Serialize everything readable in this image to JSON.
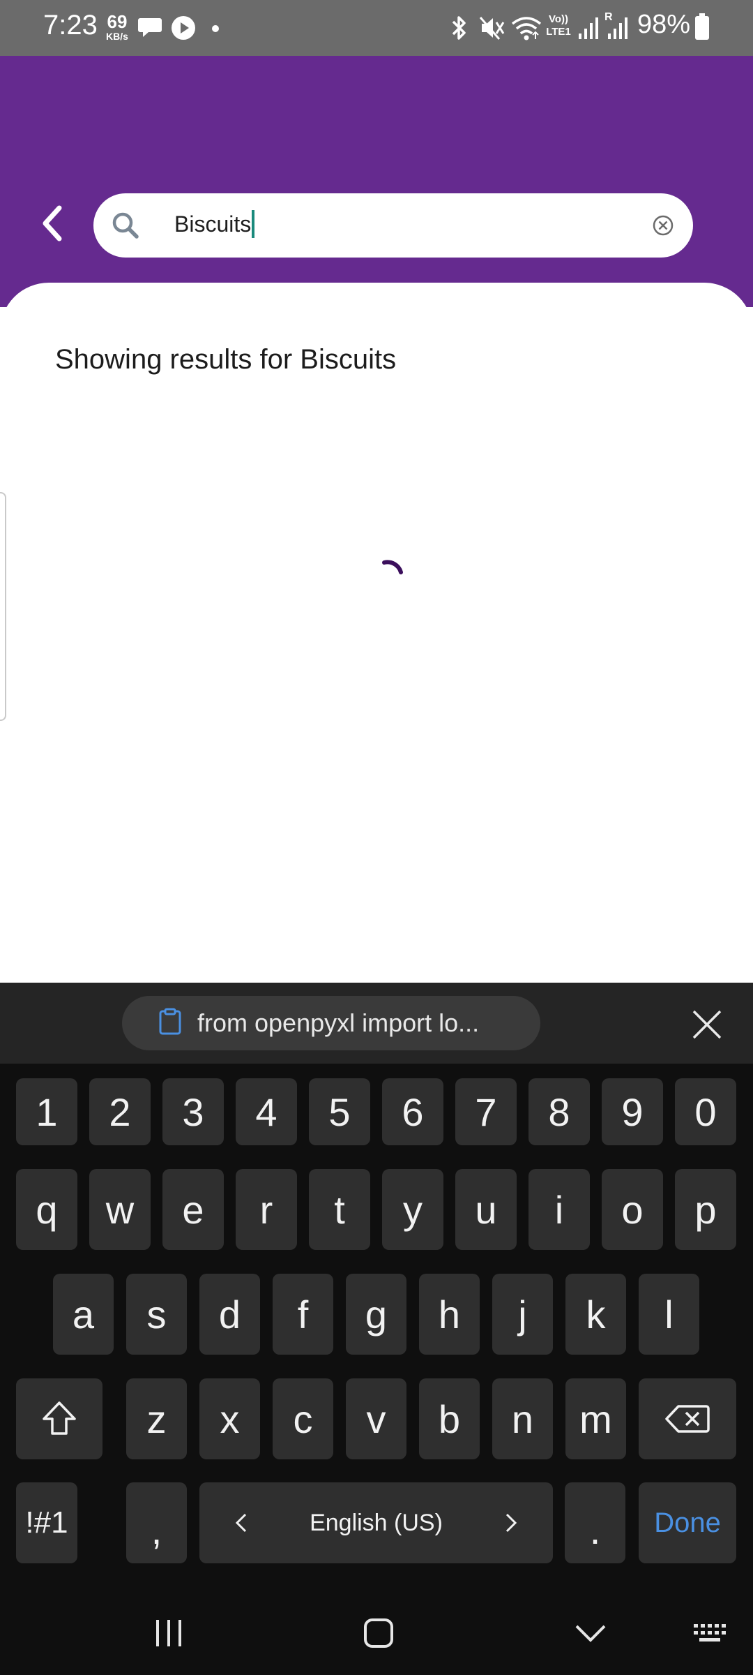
{
  "status_bar": {
    "time": "7:23",
    "speed_value": "69",
    "speed_unit": "KB/s",
    "network_label_top": "Vo))",
    "network_label_bottom": "LTE1",
    "roaming_label": "R",
    "battery": "98%"
  },
  "search": {
    "query": "Biscuits"
  },
  "results": {
    "message": "Showing results for Biscuits"
  },
  "keyboard": {
    "clipboard_text": "from openpyxl import lo...",
    "number_row": [
      "1",
      "2",
      "3",
      "4",
      "5",
      "6",
      "7",
      "8",
      "9",
      "0"
    ],
    "row1": [
      "q",
      "w",
      "e",
      "r",
      "t",
      "y",
      "u",
      "i",
      "o",
      "p"
    ],
    "row2": [
      "a",
      "s",
      "d",
      "f",
      "g",
      "h",
      "j",
      "k",
      "l"
    ],
    "row3": [
      "z",
      "x",
      "c",
      "v",
      "b",
      "n",
      "m"
    ],
    "symbols_label": "!#1",
    "comma_label": ",",
    "language_label": "English (US)",
    "period_label": ".",
    "done_label": "Done"
  },
  "colors": {
    "header_purple": "#652a8f",
    "spinner": "#3b0f5c",
    "done_blue": "#4a90e2",
    "caret_teal": "#1a8a7c"
  }
}
